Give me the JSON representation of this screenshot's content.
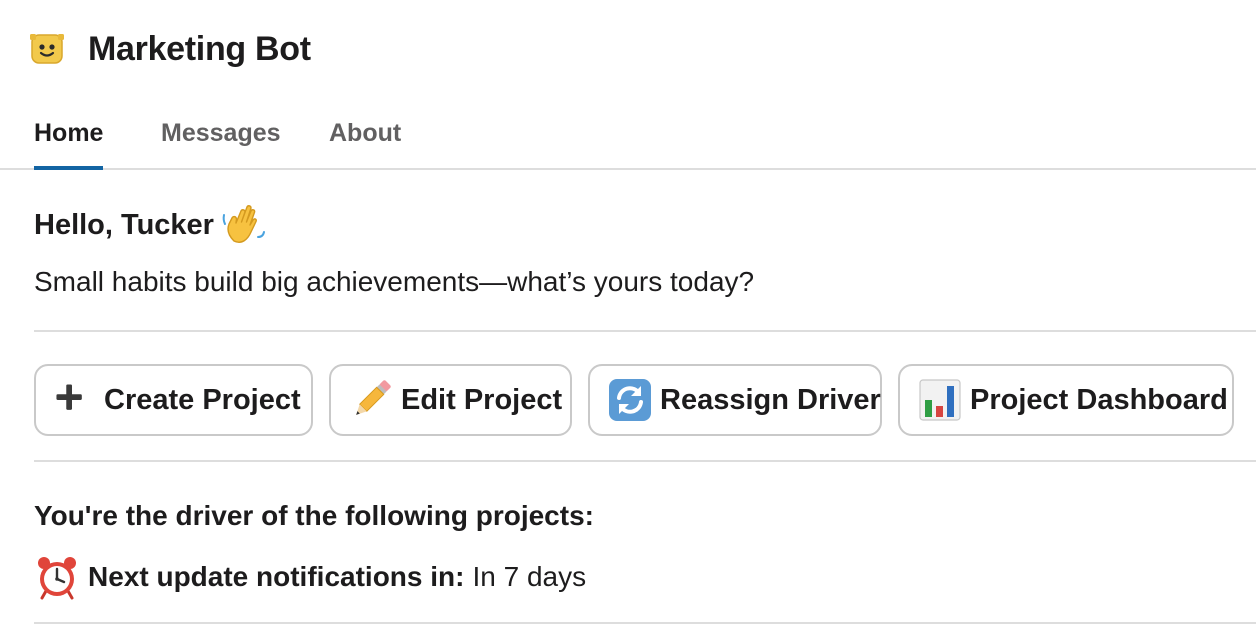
{
  "bot": {
    "name": "Marketing Bot",
    "avatar_icon": "bot-face-icon"
  },
  "tabs": [
    {
      "label": "Home",
      "active": true
    },
    {
      "label": "Messages",
      "active": false
    },
    {
      "label": "About",
      "active": false
    }
  ],
  "home": {
    "greeting": "Hello, Tucker",
    "greeting_icon": "waving-hand-icon",
    "subtitle": "Small habits build big achievements—what’s yours today?",
    "buttons": [
      {
        "label": "Create Project",
        "icon": "plus-icon"
      },
      {
        "label": "Edit Project",
        "icon": "pencil-icon"
      },
      {
        "label": "Reassign Driver",
        "icon": "refresh-arrows-icon"
      },
      {
        "label": "Project Dashboard",
        "icon": "bar-chart-icon"
      }
    ],
    "driver_heading": "You're the driver of the following projects:",
    "next_update": {
      "icon": "alarm-clock-icon",
      "label": "Next update notifications in:",
      "value": "In 7 days"
    }
  },
  "colors": {
    "text": "#1d1c1d",
    "muted_text": "#616061",
    "tab_active_underline": "#1264a3",
    "divider": "#dddddd",
    "button_border": "#c9c9c9"
  }
}
